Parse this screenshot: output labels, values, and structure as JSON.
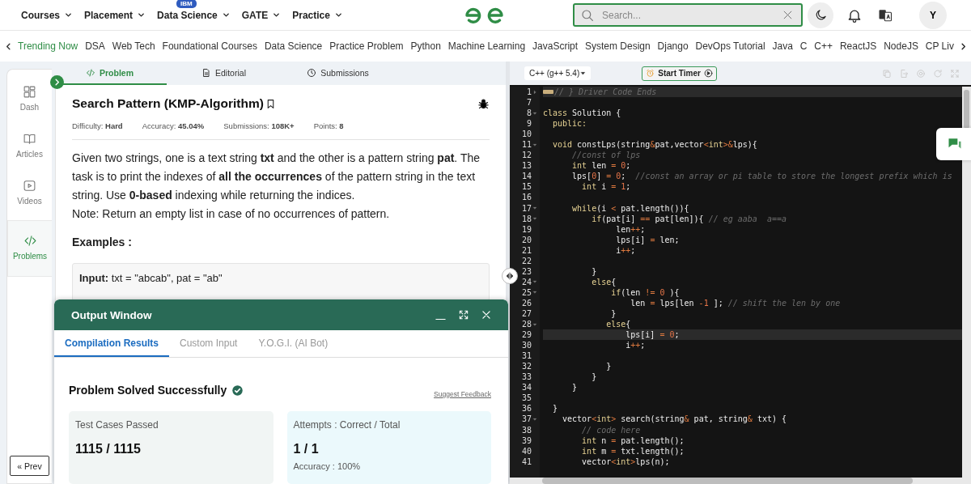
{
  "top_nav": {
    "menus": [
      {
        "label": "Courses"
      },
      {
        "label": "Placement"
      },
      {
        "label": "Data Science",
        "badge": "IBM"
      },
      {
        "label": "GATE"
      },
      {
        "label": "Practice"
      }
    ],
    "search": {
      "placeholder": "Search..."
    },
    "avatar": "Y"
  },
  "trending": {
    "label": "Trending Now",
    "items": [
      "DSA",
      "Web Tech",
      "Foundational Courses",
      "Data Science",
      "Practice Problem",
      "Python",
      "Machine Learning",
      "JavaScript",
      "System Design",
      "Django",
      "DevOps Tutorial",
      "Java",
      "C",
      "C++",
      "ReactJS",
      "NodeJS",
      "CP Liv"
    ]
  },
  "sidebar": {
    "items": [
      {
        "label": "Dash",
        "kind": "dash",
        "selected": false
      },
      {
        "label": "Articles",
        "kind": "book",
        "selected": false
      },
      {
        "label": "Videos",
        "kind": "video",
        "selected": false
      },
      {
        "label": "Problems",
        "kind": "code",
        "selected": true
      }
    ],
    "prev_button": "« Prev"
  },
  "problem": {
    "tabs": [
      {
        "label": "Problem",
        "kind": "code",
        "selected": true
      },
      {
        "label": "Editorial",
        "kind": "doc",
        "selected": false
      },
      {
        "label": "Submissions",
        "kind": "clock",
        "selected": false
      }
    ],
    "title": "Search Pattern (KMP-Algorithm)",
    "meta": [
      "Difficulty: **Hard**",
      "Accuracy: **45.04%**",
      "Submissions: **108K+**",
      "Points: **8**"
    ],
    "description": "Given two strings, one is a text string **txt** and the other is a pattern string **pat**. The task is to print the indexes of **all the occurrences** of the pattern string in the text string. Use **0-based** indexing while returning the indices.",
    "note": "Note: Return an empty list in case of no occurrences of pattern.",
    "examples_heading": "Examples :",
    "example_input": "**Input:** txt = \"abcab\", pat = \"ab\""
  },
  "output_window": {
    "title": "Output Window",
    "tabs": [
      {
        "label": "Compilation Results",
        "selected": true
      },
      {
        "label": "Custom Input",
        "selected": false
      },
      {
        "label": "Y.O.G.I. (AI Bot)",
        "selected": false
      }
    ],
    "status": "Problem Solved Successfully",
    "feedback_link": "Suggest Feedback",
    "cards": [
      {
        "label": "Test Cases Passed",
        "value": "1115 / 1115"
      },
      {
        "label": "Attempts : Correct / Total",
        "value": "1 / 1",
        "extra": "Accuracy : 100%"
      }
    ]
  },
  "editor": {
    "language": "C++ (g++ 5.4)",
    "timer_button": "Start Timer",
    "lines": [
      {
        "number": "1",
        "kind": "folded",
        "highlighted": true,
        "parts": [
          {
            "kind": "comment",
            "text": "// } Driver Code Ends"
          }
        ]
      },
      {
        "number": "7",
        "kind": "plain",
        "highlighted": false
      },
      {
        "number": "8",
        "kind": "foldable",
        "highlighted": false,
        "parts": [
          {
            "kind": "keyword",
            "text": "class"
          },
          {
            "kind": "plain",
            "text": " Solution {"
          }
        ]
      },
      {
        "number": "9",
        "kind": "plain",
        "highlighted": false,
        "parts": [
          {
            "kind": "keyword",
            "text": "  public:"
          }
        ]
      },
      {
        "number": "10",
        "kind": "plain",
        "highlighted": false
      },
      {
        "number": "11",
        "kind": "foldable",
        "highlighted": false,
        "parts": [
          {
            "kind": "keyword",
            "text": "  void"
          },
          {
            "kind": "plain",
            "text": " constLps(string"
          },
          {
            "kind": "operator",
            "text": "&"
          },
          {
            "kind": "plain",
            "text": "pat,vector"
          },
          {
            "kind": "operator",
            "text": "<"
          },
          {
            "kind": "keyword",
            "text": "int"
          },
          {
            "kind": "operator",
            "text": ">&"
          },
          {
            "kind": "plain",
            "text": "lps){"
          }
        ]
      },
      {
        "number": "12",
        "kind": "plain",
        "highlighted": false,
        "parts": [
          {
            "kind": "comment",
            "text": "      //const of lps"
          }
        ]
      },
      {
        "number": "13",
        "kind": "plain",
        "highlighted": false,
        "parts": [
          {
            "kind": "keyword",
            "text": "      int"
          },
          {
            "kind": "plain",
            "text": " len "
          },
          {
            "kind": "operator",
            "text": "= "
          },
          {
            "kind": "number",
            "text": "0"
          },
          {
            "kind": "plain",
            "text": ";"
          }
        ]
      },
      {
        "number": "14",
        "kind": "plain",
        "highlighted": false,
        "parts": [
          {
            "kind": "plain",
            "text": "      lps["
          },
          {
            "kind": "number",
            "text": "0"
          },
          {
            "kind": "plain",
            "text": "] "
          },
          {
            "kind": "operator",
            "text": "= "
          },
          {
            "kind": "number",
            "text": "0"
          },
          {
            "kind": "plain",
            "text": ";  "
          },
          {
            "kind": "comment",
            "text": "//const an array or pi table to store the longest prefix which is"
          }
        ]
      },
      {
        "number": "15",
        "kind": "plain",
        "highlighted": false,
        "parts": [
          {
            "kind": "keyword",
            "text": "        int"
          },
          {
            "kind": "plain",
            "text": " i "
          },
          {
            "kind": "operator",
            "text": "= "
          },
          {
            "kind": "number",
            "text": "1"
          },
          {
            "kind": "plain",
            "text": ";"
          }
        ]
      },
      {
        "number": "16",
        "kind": "plain",
        "highlighted": false
      },
      {
        "number": "17",
        "kind": "foldable",
        "highlighted": false,
        "parts": [
          {
            "kind": "keyword",
            "text": "      while"
          },
          {
            "kind": "plain",
            "text": "(i "
          },
          {
            "kind": "operator",
            "text": "<"
          },
          {
            "kind": "plain",
            "text": " pat.length()){"
          }
        ]
      },
      {
        "number": "18",
        "kind": "foldable",
        "highlighted": false,
        "parts": [
          {
            "kind": "keyword",
            "text": "          if"
          },
          {
            "kind": "plain",
            "text": "(pat[i] "
          },
          {
            "kind": "operator",
            "text": "=="
          },
          {
            "kind": "plain",
            "text": " pat[len]){ "
          },
          {
            "kind": "comment",
            "text": "// eg aaba  a==a"
          }
        ]
      },
      {
        "number": "19",
        "kind": "plain",
        "highlighted": false,
        "parts": [
          {
            "kind": "plain",
            "text": "               len"
          },
          {
            "kind": "operator",
            "text": "++"
          },
          {
            "kind": "plain",
            "text": ";"
          }
        ]
      },
      {
        "number": "20",
        "kind": "plain",
        "highlighted": false,
        "parts": [
          {
            "kind": "plain",
            "text": "               lps[i] "
          },
          {
            "kind": "operator",
            "text": "="
          },
          {
            "kind": "plain",
            "text": " len;"
          }
        ]
      },
      {
        "number": "21",
        "kind": "plain",
        "highlighted": false,
        "parts": [
          {
            "kind": "plain",
            "text": "               i"
          },
          {
            "kind": "operator",
            "text": "++"
          },
          {
            "kind": "plain",
            "text": ";"
          }
        ]
      },
      {
        "number": "22",
        "kind": "plain",
        "highlighted": false
      },
      {
        "number": "23",
        "kind": "plain",
        "highlighted": false,
        "parts": [
          {
            "kind": "plain",
            "text": "          }"
          }
        ]
      },
      {
        "number": "24",
        "kind": "foldable",
        "highlighted": false,
        "parts": [
          {
            "kind": "keyword",
            "text": "          else"
          },
          {
            "kind": "plain",
            "text": "{"
          }
        ]
      },
      {
        "number": "25",
        "kind": "foldable",
        "highlighted": false,
        "parts": [
          {
            "kind": "keyword",
            "text": "              if"
          },
          {
            "kind": "plain",
            "text": "(len "
          },
          {
            "kind": "operator",
            "text": "!= "
          },
          {
            "kind": "number",
            "text": "0"
          },
          {
            "kind": "plain",
            "text": " ){"
          }
        ]
      },
      {
        "number": "26",
        "kind": "plain",
        "highlighted": false,
        "parts": [
          {
            "kind": "plain",
            "text": "                  len "
          },
          {
            "kind": "operator",
            "text": "="
          },
          {
            "kind": "plain",
            "text": " lps[len "
          },
          {
            "kind": "operator",
            "text": "-"
          },
          {
            "kind": "number",
            "text": "1"
          },
          {
            "kind": "plain",
            "text": " ]; "
          },
          {
            "kind": "comment",
            "text": "// shift the len by one"
          }
        ]
      },
      {
        "number": "27",
        "kind": "plain",
        "highlighted": false,
        "parts": [
          {
            "kind": "plain",
            "text": "              }"
          }
        ]
      },
      {
        "number": "28",
        "kind": "foldable",
        "highlighted": false,
        "parts": [
          {
            "kind": "keyword",
            "text": "             else"
          },
          {
            "kind": "plain",
            "text": "{"
          }
        ]
      },
      {
        "number": "29",
        "kind": "plain",
        "highlighted": true,
        "parts": [
          {
            "kind": "plain",
            "text": "                 lps[i] "
          },
          {
            "kind": "operator",
            "text": "= "
          },
          {
            "kind": "number",
            "text": "0"
          },
          {
            "kind": "plain",
            "text": ";"
          }
        ]
      },
      {
        "number": "30",
        "kind": "plain",
        "highlighted": false,
        "parts": [
          {
            "kind": "plain",
            "text": "                 i"
          },
          {
            "kind": "operator",
            "text": "++"
          },
          {
            "kind": "plain",
            "text": ";"
          }
        ]
      },
      {
        "number": "31",
        "kind": "plain",
        "highlighted": false
      },
      {
        "number": "32",
        "kind": "plain",
        "highlighted": false,
        "parts": [
          {
            "kind": "plain",
            "text": "             }"
          }
        ]
      },
      {
        "number": "33",
        "kind": "plain",
        "highlighted": false,
        "parts": [
          {
            "kind": "plain",
            "text": "          }"
          }
        ]
      },
      {
        "number": "34",
        "kind": "plain",
        "highlighted": false,
        "parts": [
          {
            "kind": "plain",
            "text": "      }"
          }
        ]
      },
      {
        "number": "35",
        "kind": "plain",
        "highlighted": false
      },
      {
        "number": "36",
        "kind": "plain",
        "highlighted": false,
        "parts": [
          {
            "kind": "plain",
            "text": "  }"
          }
        ]
      },
      {
        "number": "37",
        "kind": "foldable",
        "highlighted": false,
        "parts": [
          {
            "kind": "plain",
            "text": "    vector"
          },
          {
            "kind": "operator",
            "text": "<"
          },
          {
            "kind": "keyword",
            "text": "int"
          },
          {
            "kind": "operator",
            "text": ">"
          },
          {
            "kind": "plain",
            "text": " search(string"
          },
          {
            "kind": "operator",
            "text": "&"
          },
          {
            "kind": "plain",
            "text": " pat, string"
          },
          {
            "kind": "operator",
            "text": "&"
          },
          {
            "kind": "plain",
            "text": " txt) {"
          }
        ]
      },
      {
        "number": "38",
        "kind": "plain",
        "highlighted": false,
        "parts": [
          {
            "kind": "comment",
            "text": "        // code here"
          }
        ]
      },
      {
        "number": "39",
        "kind": "plain",
        "highlighted": false,
        "parts": [
          {
            "kind": "keyword",
            "text": "        int"
          },
          {
            "kind": "plain",
            "text": " n "
          },
          {
            "kind": "operator",
            "text": "="
          },
          {
            "kind": "plain",
            "text": " pat.length();"
          }
        ]
      },
      {
        "number": "40",
        "kind": "plain",
        "highlighted": false,
        "parts": [
          {
            "kind": "keyword",
            "text": "        int"
          },
          {
            "kind": "plain",
            "text": " m "
          },
          {
            "kind": "operator",
            "text": "="
          },
          {
            "kind": "plain",
            "text": " txt.length();"
          }
        ]
      },
      {
        "number": "41",
        "kind": "plain",
        "highlighted": false,
        "parts": [
          {
            "kind": "plain",
            "text": "        vector"
          },
          {
            "kind": "operator",
            "text": "<"
          },
          {
            "kind": "keyword",
            "text": "int"
          },
          {
            "kind": "operator",
            "text": ">"
          },
          {
            "kind": "plain",
            "text": "lps(n);"
          }
        ]
      }
    ]
  }
}
